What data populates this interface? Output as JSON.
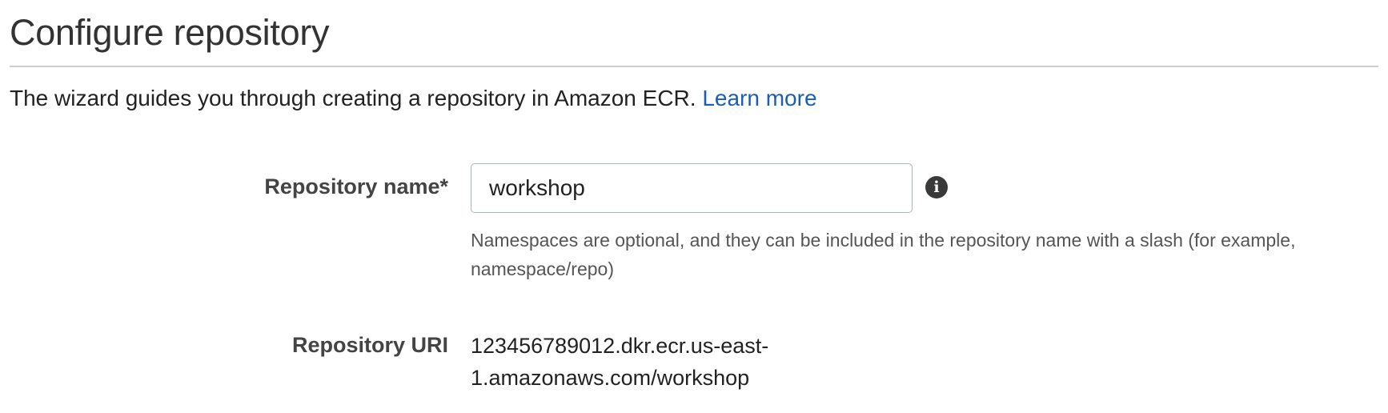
{
  "page": {
    "title": "Configure repository",
    "intro_text": "The wizard guides you through creating a repository in Amazon ECR. ",
    "learn_more_label": "Learn more"
  },
  "form": {
    "repository_name": {
      "label": "Repository name*",
      "value": "workshop",
      "info_icon": "info-icon",
      "info_glyph": "i",
      "help_text": "Namespaces are optional, and they can be included in the repository name with a slash (for example, namespace/repo)"
    },
    "repository_uri": {
      "label": "Repository URI",
      "line1": "123456789012.dkr.ecr.us-east-",
      "line2": "1.amazonaws.com/workshop"
    }
  },
  "colors": {
    "link": "#1a5fb4",
    "text": "#222222",
    "muted": "#555555",
    "divider": "#cfcfcf",
    "input_border": "#aab7b8"
  }
}
